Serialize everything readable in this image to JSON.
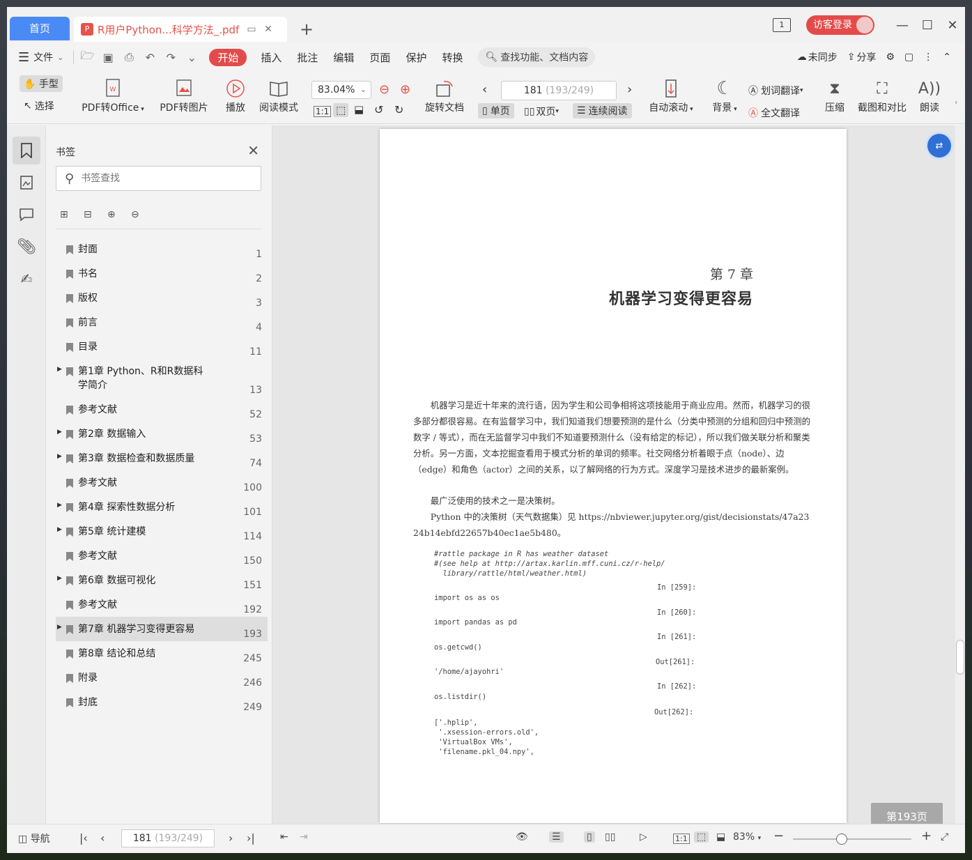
{
  "tabs": {
    "home": "首页",
    "doc_title": "R用户Python...科学方法_.pdf",
    "add": "+"
  },
  "titlebar": {
    "doc_count": "1",
    "login": "访客登录"
  },
  "menu": {
    "file": "文件",
    "items": [
      "开始",
      "插入",
      "批注",
      "编辑",
      "页面",
      "保护",
      "转换"
    ],
    "search_placeholder": "查找功能、文档内容",
    "unsynced": "未同步",
    "share": "分享"
  },
  "ribbon": {
    "hand": "手型",
    "select": "选择",
    "pdf_to_office": "PDF转Office",
    "pdf_to_image": "PDF转图片",
    "play": "播放",
    "read_mode": "阅读模式",
    "zoom": "83.04%",
    "rotate": "旋转文档",
    "page_current": "181",
    "page_total": "(193/249)",
    "single": "单页",
    "double": "双页",
    "continuous": "连续阅读",
    "auto_scroll": "自动滚动",
    "background": "背景",
    "word_translate": "划词翻译",
    "full_translate": "全文翻译",
    "compress": "压缩",
    "screenshot_compare": "截图和对比",
    "read_aloud": "朗读"
  },
  "panel": {
    "title": "书签",
    "search_placeholder": "书签查找",
    "bookmarks": [
      {
        "label": "封面",
        "page": "1",
        "expandable": false
      },
      {
        "label": "书名",
        "page": "2",
        "expandable": false
      },
      {
        "label": "版权",
        "page": "3",
        "expandable": false
      },
      {
        "label": "前言",
        "page": "4",
        "expandable": false
      },
      {
        "label": "目录",
        "page": "11",
        "expandable": false
      },
      {
        "label": "第1章 Python、R和R数据科学简介",
        "page": "13",
        "expandable": true
      },
      {
        "label": "参考文献",
        "page": "52",
        "expandable": false
      },
      {
        "label": "第2章 数据输入",
        "page": "53",
        "expandable": true
      },
      {
        "label": "第3章 数据检查和数据质量",
        "page": "74",
        "expandable": true
      },
      {
        "label": "参考文献",
        "page": "100",
        "expandable": false
      },
      {
        "label": "第4章 探索性数据分析",
        "page": "101",
        "expandable": true
      },
      {
        "label": "第5章 统计建模",
        "page": "114",
        "expandable": true
      },
      {
        "label": "参考文献",
        "page": "150",
        "expandable": false
      },
      {
        "label": "第6章 数据可视化",
        "page": "151",
        "expandable": true
      },
      {
        "label": "参考文献",
        "page": "192",
        "expandable": false
      },
      {
        "label": "第7章 机器学习变得更容易",
        "page": "193",
        "expandable": true,
        "selected": true
      },
      {
        "label": "第8章 结论和总结",
        "page": "245",
        "expandable": false
      },
      {
        "label": "附录",
        "page": "246",
        "expandable": false
      },
      {
        "label": "封底",
        "page": "249",
        "expandable": false
      }
    ]
  },
  "document": {
    "chapter_num": "第 7 章",
    "chapter_title": "机器学习变得更容易",
    "para1": "机器学习是近十年来的流行语，因为学生和公司争相将这项技能用于商业应用。然而，机器学习的很多部分都很容易。在有监督学习中，我们知道我们想要预测的是什么（分类中预测的分组和回归中预测的数字 / 等式），而在无监督学习中我们不知道要预测什么（没有给定的标记），所以我们做关联分析和聚类分析。另一方面，文本挖掘查看用于模式分析的单词的频率。社交网络分析着眼于点（node）、边（edge）和角色（actor）之间的关系，以了解网络的行为方式。深度学习是技术进步的最新案例。",
    "para2": "最广泛使用的技术之一是决策树。",
    "para3": "Python 中的决策树（天气数据集）见 https://nbviewer.jupyter.org/gist/decisionstats/47a2324b14ebfd22657b40ec1ae5b480。",
    "code_comment": "#rattle package in R has weather dataset\n#(see help at http://artax.karlin.mff.cuni.cz/r-help/\n  library/rattle/html/weather.html)",
    "in259": "In [259]:",
    "code1": "import os as os",
    "in260": "In [260]:",
    "code2": "import pandas as pd",
    "in261": "In [261]:",
    "code3": "os.getcwd()",
    "out261": "Out[261]:",
    "code4": "'/home/ajayohri'",
    "in262": "In [262]:",
    "code5": "os.listdir()",
    "out262": "Out[262]:",
    "code6": "['.hplip',\n '.xsession-errors.old',\n 'VirtualBox VMs',\n 'filename.pkl_04.npy',",
    "page_badge": "第193页"
  },
  "statusbar": {
    "nav": "导航",
    "page_current": "181",
    "page_total": "(193/249)",
    "zoom": "83%"
  }
}
